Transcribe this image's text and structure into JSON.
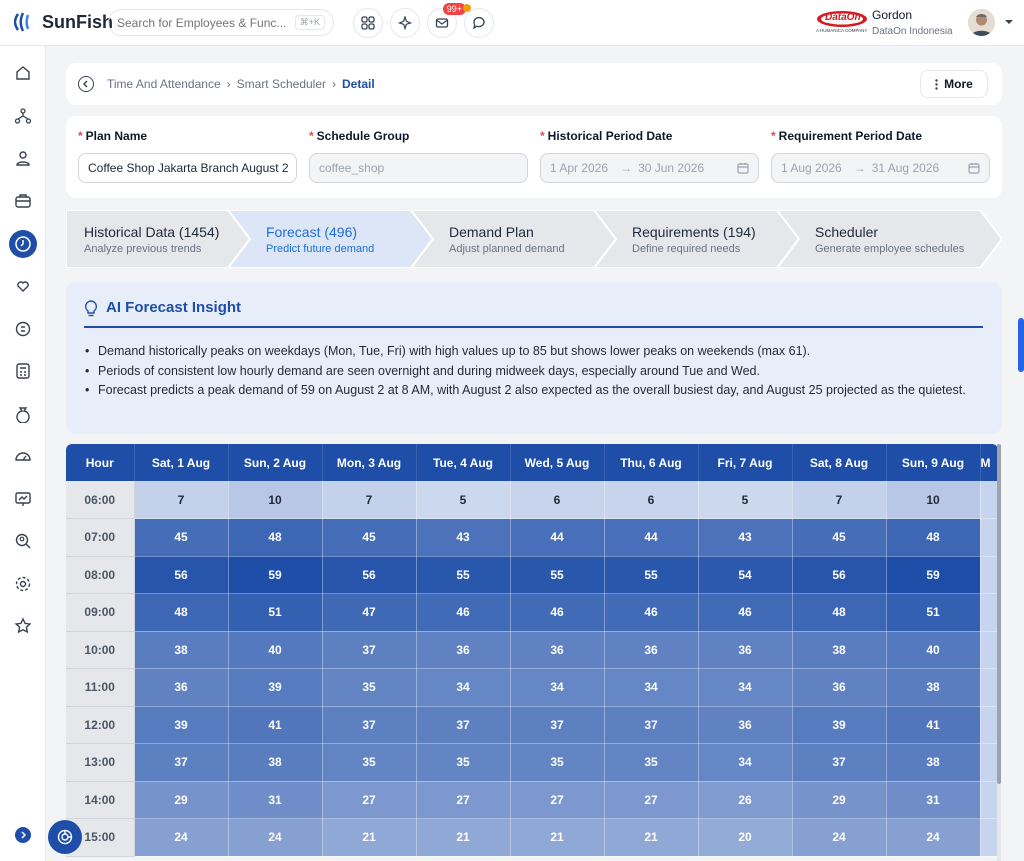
{
  "app": {
    "name": "SunFish"
  },
  "search": {
    "placeholder": "Search for Employees & Func...",
    "shortcut": "⌘+K"
  },
  "topbar": {
    "notification_badge": "99+"
  },
  "user": {
    "name": "Gordon",
    "company": "DataOn Indonesia",
    "brand_logo": "DataOn",
    "brand_tagline": "A HUMANICA COMPANY"
  },
  "breadcrumb": {
    "items": [
      "Time And Attendance",
      "Smart Scheduler"
    ],
    "current": "Detail"
  },
  "more_label": "More",
  "form": {
    "plan_name": {
      "label": "Plan Name",
      "value": "Coffee Shop Jakarta Branch August 2"
    },
    "schedule_group": {
      "label": "Schedule Group",
      "value": "coffee_shop"
    },
    "historical": {
      "label": "Historical Period Date",
      "start": "1 Apr 2026",
      "end": "30 Jun 2026"
    },
    "requirement": {
      "label": "Requirement Period Date",
      "start": "1 Aug 2026",
      "end": "31 Aug 2026"
    }
  },
  "steps": [
    {
      "title": "Historical Data (1454)",
      "subtitle": "Analyze previous trends"
    },
    {
      "title": "Forecast (496)",
      "subtitle": "Predict future demand"
    },
    {
      "title": "Demand Plan",
      "subtitle": "Adjust planned demand"
    },
    {
      "title": "Requirements (194)",
      "subtitle": "Define required needs"
    },
    {
      "title": "Scheduler",
      "subtitle": "Generate employee schedules"
    }
  ],
  "insight": {
    "title": "AI Forecast Insight",
    "bullets": [
      "Demand historically peaks on weekdays (Mon, Tue, Fri) with high values up to 85 but shows lower peaks on weekends (max 61).",
      "Periods of consistent low hourly demand are seen overnight and during midweek days, especially around Tue and Wed.",
      "Forecast predicts a peak demand of 59 on August 2 at 8 AM, with August 2 also expected as the overall busiest day, and August 25 projected as the quietest."
    ]
  },
  "table": {
    "hour_header": "Hour",
    "days": [
      "Sat, 1 Aug",
      "Sun, 2 Aug",
      "Mon, 3 Aug",
      "Tue, 4 Aug",
      "Wed, 5 Aug",
      "Thu, 6 Aug",
      "Fri, 7 Aug",
      "Sat, 8 Aug",
      "Sun, 9 Aug",
      "M"
    ],
    "rows": [
      {
        "hour": "06:00",
        "values": [
          7,
          10,
          7,
          5,
          6,
          6,
          5,
          7,
          10,
          null
        ]
      },
      {
        "hour": "07:00",
        "values": [
          45,
          48,
          45,
          43,
          44,
          44,
          43,
          45,
          48,
          null
        ]
      },
      {
        "hour": "08:00",
        "values": [
          56,
          59,
          56,
          55,
          55,
          55,
          54,
          56,
          59,
          null
        ]
      },
      {
        "hour": "09:00",
        "values": [
          48,
          51,
          47,
          46,
          46,
          46,
          46,
          48,
          51,
          null
        ]
      },
      {
        "hour": "10:00",
        "values": [
          38,
          40,
          37,
          36,
          36,
          36,
          36,
          38,
          40,
          null
        ]
      },
      {
        "hour": "11:00",
        "values": [
          36,
          39,
          35,
          34,
          34,
          34,
          34,
          36,
          38,
          null
        ]
      },
      {
        "hour": "12:00",
        "values": [
          39,
          41,
          37,
          37,
          37,
          37,
          36,
          39,
          41,
          null
        ]
      },
      {
        "hour": "13:00",
        "values": [
          37,
          38,
          35,
          35,
          35,
          35,
          34,
          37,
          38,
          null
        ]
      },
      {
        "hour": "14:00",
        "values": [
          29,
          31,
          27,
          27,
          27,
          27,
          26,
          29,
          31,
          null
        ]
      },
      {
        "hour": "15:00",
        "values": [
          24,
          24,
          21,
          21,
          21,
          21,
          20,
          24,
          24,
          null
        ]
      }
    ]
  },
  "colors": {
    "accent": "#1e4ea8",
    "heat_low": "#e8eef9",
    "heat_high": "#1e4ea8"
  },
  "sidebar": {
    "icons": [
      "home-icon",
      "org-chart-icon",
      "user-icon",
      "briefcase-icon",
      "clock-icon",
      "heart-hand-icon",
      "money-cycle-icon",
      "calculator-icon",
      "money-bag-icon",
      "dashboard-icon",
      "chart-board-icon",
      "search-user-icon",
      "settings-icon",
      "star-icon"
    ],
    "active_index": 4
  }
}
